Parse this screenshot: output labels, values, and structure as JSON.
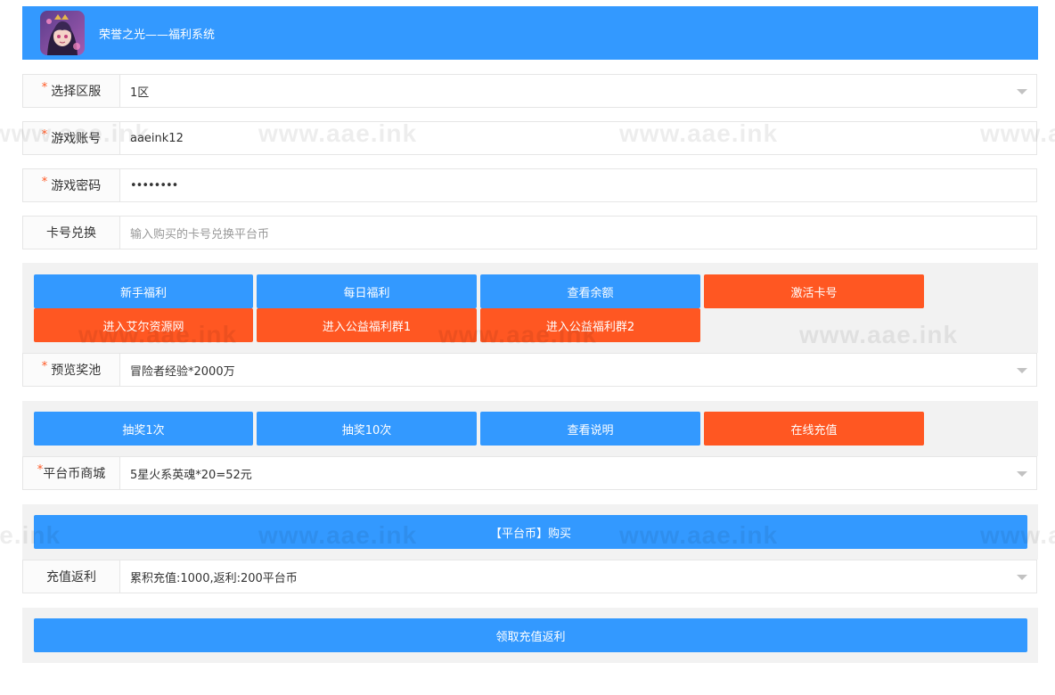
{
  "header": {
    "title": "荣誉之光——福利系统"
  },
  "watermark": "www.aae.ink",
  "form": {
    "server": {
      "label": "选择区服",
      "value": "1区"
    },
    "account": {
      "label": "游戏账号",
      "value": "aaeink12"
    },
    "password": {
      "label": "游戏密码",
      "value": "••••••••"
    },
    "card": {
      "label": "卡号兑换",
      "placeholder": "输入购买的卡号兑换平台币"
    }
  },
  "actions1": [
    "新手福利",
    "每日福利",
    "查看余额",
    "激活卡号",
    "进入艾尔资源网",
    "进入公益福利群1",
    "进入公益福利群2"
  ],
  "pool": {
    "label": "预览奖池",
    "value": "冒险者经验*2000万"
  },
  "actions2": [
    "抽奖1次",
    "抽奖10次",
    "查看说明",
    "在线充值"
  ],
  "mall": {
    "label": "平台币商城",
    "value": "5星火系英魂*20=52元"
  },
  "buy_button": "【平台币】购买",
  "rebate": {
    "label": "充值返利",
    "value": "累积充值:1000,返利:200平台币"
  },
  "claim_button": "领取充值返利",
  "colors": {
    "primary": "#3399ff",
    "accent": "#ff5722"
  }
}
